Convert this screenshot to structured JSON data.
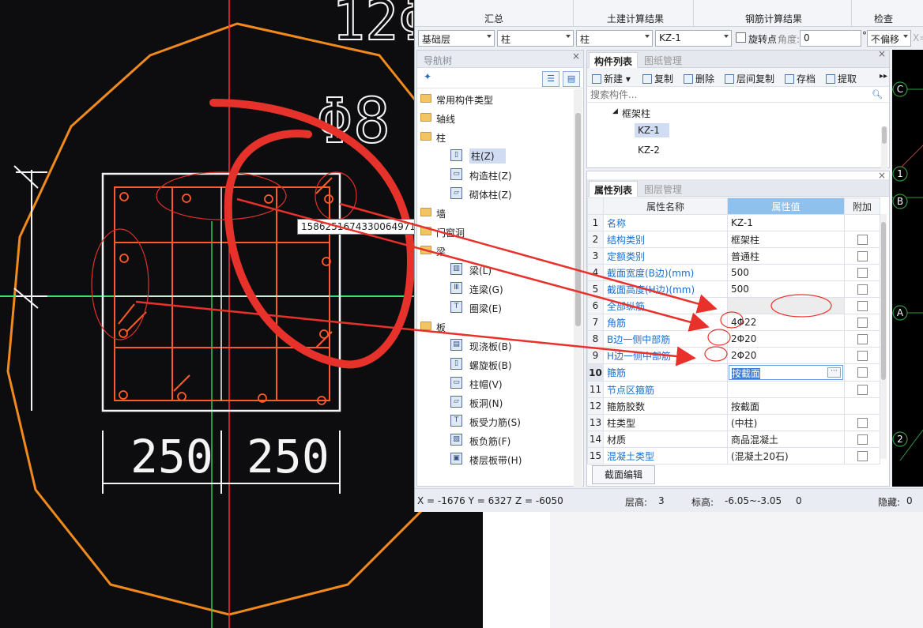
{
  "photo": {
    "filename": "1586251674330064971.jpg",
    "dim_labels": [
      "250",
      "250"
    ],
    "rebar_label": "Φ8"
  },
  "menu": {
    "tabs": [
      "汇总",
      "土建计算结果",
      "钢筋计算结果",
      "检查"
    ]
  },
  "toolbar": {
    "floor": "基础层",
    "category": "柱",
    "type": "柱",
    "component": "KZ-1",
    "rotate_label": "旋转点",
    "angle_label": "角度:",
    "angle_value": "0",
    "degree_symbol": "°",
    "offset": "不偏移",
    "x_label": "X="
  },
  "nav": {
    "title": "导航树",
    "items": [
      {
        "label": "常用构件类型",
        "level": 0
      },
      {
        "label": "轴线",
        "level": 0
      },
      {
        "label": "柱",
        "level": 0
      },
      {
        "label": "柱(Z)",
        "level": 1,
        "selected": true
      },
      {
        "label": "构造柱(Z)",
        "level": 1
      },
      {
        "label": "砌体柱(Z)",
        "level": 1
      },
      {
        "label": "墙",
        "level": 0
      },
      {
        "label": "门窗洞",
        "level": 0
      },
      {
        "label": "梁",
        "level": 0
      },
      {
        "label": "梁(L)",
        "level": 1
      },
      {
        "label": "连梁(G)",
        "level": 1
      },
      {
        "label": "圈梁(E)",
        "level": 1
      },
      {
        "label": "板",
        "level": 0
      },
      {
        "label": "现浇板(B)",
        "level": 1
      },
      {
        "label": "螺旋板(B)",
        "level": 1
      },
      {
        "label": "柱帽(V)",
        "level": 1
      },
      {
        "label": "板洞(N)",
        "level": 1
      },
      {
        "label": "板受力筋(S)",
        "level": 1
      },
      {
        "label": "板负筋(F)",
        "level": 1
      },
      {
        "label": "楼层板带(H)",
        "level": 1
      }
    ]
  },
  "components": {
    "tabs": [
      "构件列表",
      "图纸管理"
    ],
    "toolbar": [
      "新建",
      "复制",
      "删除",
      "层间复制",
      "存档",
      "提取"
    ],
    "search_placeholder": "搜索构件...",
    "group": "框架柱",
    "items": [
      "KZ-1",
      "KZ-2"
    ],
    "selected": "KZ-1"
  },
  "properties": {
    "tabs": [
      "属性列表",
      "图层管理"
    ],
    "headers": [
      "属性名称",
      "属性值",
      "附加"
    ],
    "rows": [
      {
        "n": "1",
        "name": "名称",
        "value": "KZ-1",
        "blue": true,
        "check": false
      },
      {
        "n": "2",
        "name": "结构类别",
        "value": "框架柱",
        "blue": true,
        "check": true
      },
      {
        "n": "3",
        "name": "定额类别",
        "value": "普通柱",
        "blue": true,
        "check": true
      },
      {
        "n": "4",
        "name": "截面宽度(B边)(mm)",
        "value": "500",
        "blue": true,
        "check": true
      },
      {
        "n": "5",
        "name": "截面高度(H边)(mm)",
        "value": "500",
        "blue": true,
        "check": true
      },
      {
        "n": "6",
        "name": "全部纵筋",
        "value": "",
        "blue": true,
        "check": true,
        "grey": true
      },
      {
        "n": "7",
        "name": "角筋",
        "value": "4Φ22",
        "blue": true,
        "check": true
      },
      {
        "n": "8",
        "name": "B边一侧中部筋",
        "value": "2Φ20",
        "blue": true,
        "check": true
      },
      {
        "n": "9",
        "name": "H边一侧中部筋",
        "value": "2Φ20",
        "blue": true,
        "check": true
      },
      {
        "n": "10",
        "name": "箍筋",
        "value": "按截面",
        "blue": true,
        "check": true,
        "editing": true
      },
      {
        "n": "11",
        "name": "节点区箍筋",
        "value": "",
        "blue": true,
        "check": true
      },
      {
        "n": "12",
        "name": "箍筋胶数",
        "value": "按截面",
        "blue": false,
        "check": false
      },
      {
        "n": "13",
        "name": "柱类型",
        "value": "(中柱)",
        "blue": false,
        "check": true
      },
      {
        "n": "14",
        "name": "材质",
        "value": "商品混凝土",
        "blue": false,
        "check": true
      },
      {
        "n": "15",
        "name": "混凝土类型",
        "value": "(混凝土20石)",
        "blue": true,
        "check": true
      }
    ],
    "section_edit_button": "截面编辑"
  },
  "status": {
    "coords": "X = -1676 Y = 6327 Z = -6050",
    "floor_height_label": "层高:",
    "floor_height_value": "3",
    "elevation_label": "标高:",
    "elevation_value": "-6.05~-3.05",
    "count": "0",
    "hidden_label": "隐藏:",
    "hidden_value": "0"
  },
  "cad_axes": [
    "C",
    "1",
    "B",
    "A",
    "2"
  ]
}
